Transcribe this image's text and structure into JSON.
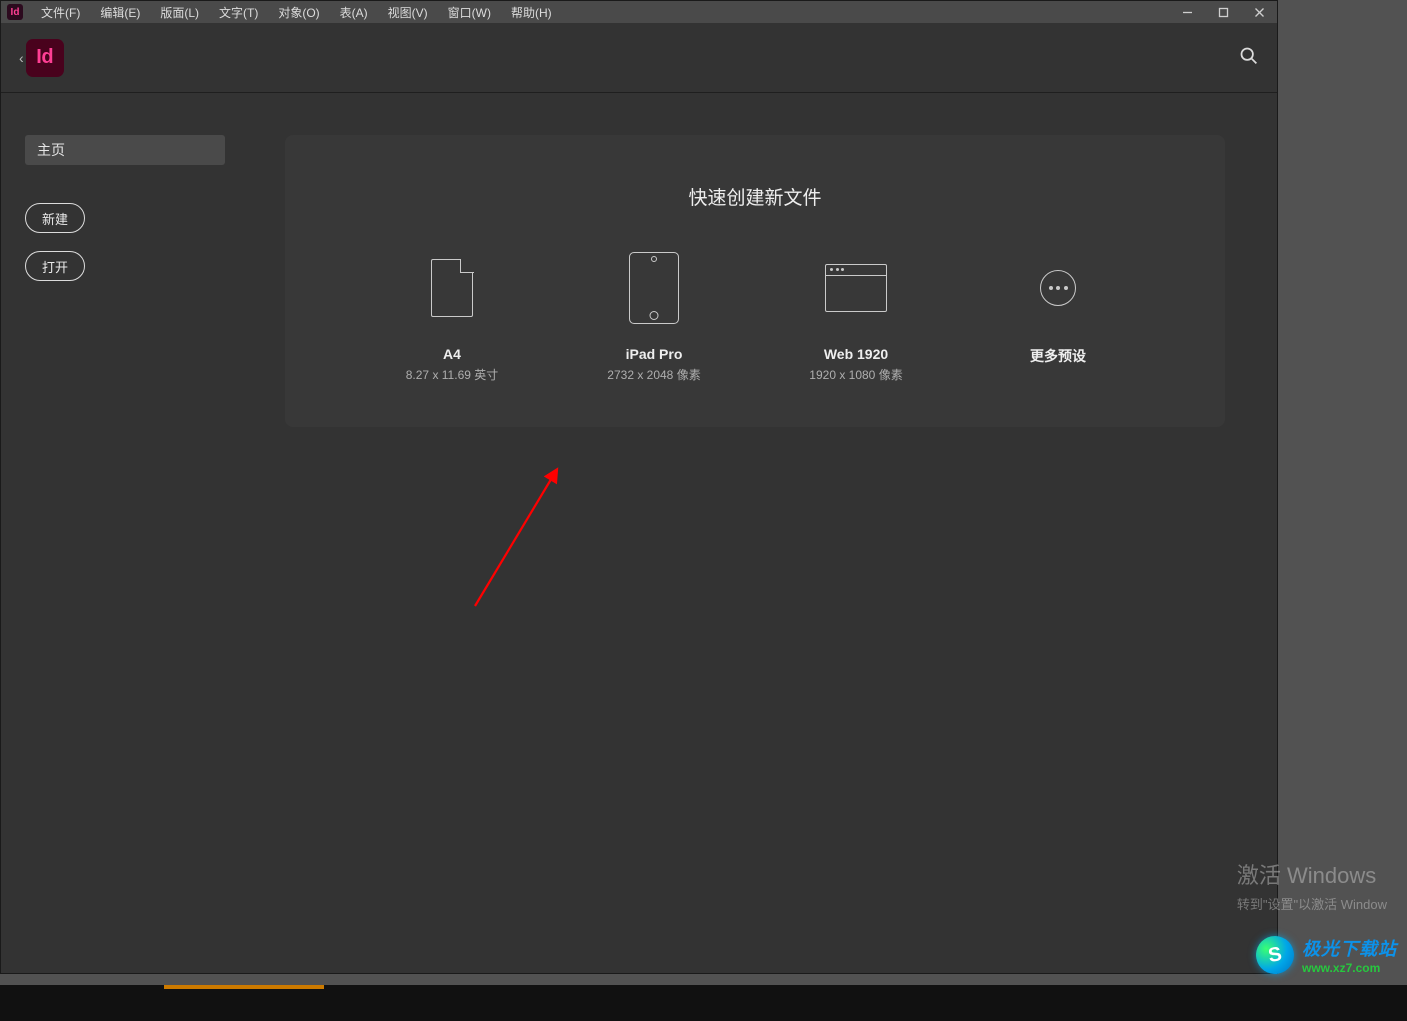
{
  "app": {
    "icon_text": "Id",
    "logo_text": "Id"
  },
  "menubar": {
    "items": [
      "文件(F)",
      "编辑(E)",
      "版面(L)",
      "文字(T)",
      "对象(O)",
      "表(A)",
      "视图(V)",
      "窗口(W)",
      "帮助(H)"
    ]
  },
  "sidebar": {
    "home_value": "主页",
    "new_label": "新建",
    "open_label": "打开"
  },
  "card": {
    "title": "快速创建新文件",
    "presets": [
      {
        "name": "A4",
        "sub": "8.27 x 11.69 英寸",
        "icon": "document-icon"
      },
      {
        "name": "iPad Pro",
        "sub": "2732 x 2048 像素",
        "icon": "ipad-icon"
      },
      {
        "name": "Web 1920",
        "sub": "1920 x 1080 像素",
        "icon": "browser-icon"
      },
      {
        "name": "更多预设",
        "sub": "",
        "icon": "more-icon"
      }
    ]
  },
  "watermark": {
    "line1": "激活 Windows",
    "line2": "转到\"设置\"以激活 Window"
  },
  "site_logo": {
    "cn": "极光下载站",
    "en": "www.xz7.com"
  }
}
